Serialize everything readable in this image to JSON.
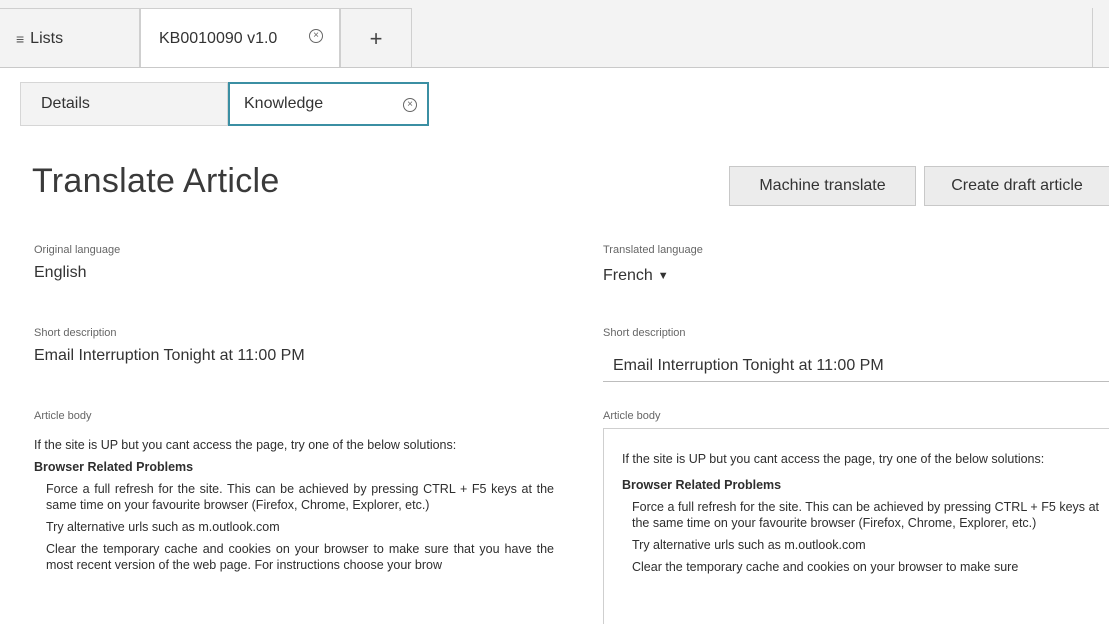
{
  "top_tabs": {
    "lists_label": "Lists",
    "record_label": "KB0010090 v1.0",
    "add_label": "+"
  },
  "sub_tabs": {
    "details_label": "Details",
    "knowledge_label": "Knowledge"
  },
  "page": {
    "title": "Translate Article"
  },
  "actions": {
    "machine_translate": "Machine translate",
    "create_draft": "Create draft article"
  },
  "original": {
    "language_label": "Original language",
    "language_value": "English",
    "short_desc_label": "Short description",
    "short_desc_value": "Email Interruption Tonight at 11:00 PM",
    "body_label": "Article body",
    "body": {
      "intro": "If the site is UP but you cant access the page, try one of the below solutions:",
      "heading": "Browser Related Problems",
      "item1": "Force a full refresh for the site. This can be achieved by pressing CTRL + F5 keys at the same time on your favourite browser (Firefox, Chrome, Explorer, etc.)",
      "item2": "Try alternative urls such as m.outlook.com",
      "item3": "Clear the temporary cache and cookies on your browser to make sure that you have the most recent version of the web page. For instructions choose your brow"
    }
  },
  "translated": {
    "language_label": "Translated language",
    "language_value": "French",
    "short_desc_label": "Short description",
    "short_desc_value": "Email Interruption Tonight at 11:00 PM",
    "body_label": "Article body",
    "body": {
      "intro": "If the site is UP but you cant access the page, try one of the below solutions:",
      "heading": "Browser Related Problems",
      "item1": "Force a full refresh for the site. This can be achieved by pressing CTRL + F5 keys at the same time on your favourite browser (Firefox, Chrome, Explorer, etc.)",
      "item2": "Try alternative urls such as m.outlook.com",
      "item3": "Clear the temporary cache and cookies on your browser to make sure"
    }
  },
  "colors": {
    "active_tab_border": "#3b8fa3",
    "tab_background": "#f3f3f3"
  }
}
